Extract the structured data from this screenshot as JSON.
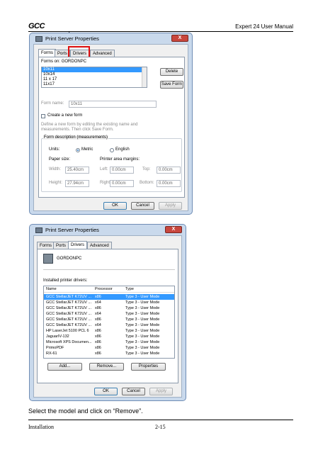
{
  "header": {
    "logo": "GCC",
    "doc_title": "Expert 24 User Manual"
  },
  "dialog1": {
    "title": "Print Server Properties",
    "tabs": [
      "Forms",
      "Ports",
      "Drivers",
      "Advanced"
    ],
    "active_tab": "Forms",
    "forms_on_label": "Forms on:",
    "server_name": "GORDONPC",
    "forms_list": [
      "10x11",
      "10x14",
      "11 x 17",
      "11x17"
    ],
    "delete_button": "Delete",
    "save_form_button": "Save Form",
    "form_name_label": "Form name:",
    "form_name_value": "10x11",
    "create_new_form_label": "Create a new form",
    "help_text_line1": "Define a new form by editing the existing name and",
    "help_text_line2": "measurements. Then click Save Form.",
    "form_description_title": "Form description (measurements)",
    "units_label": "Units:",
    "metric_label": "Metric",
    "english_label": "English",
    "paper_size_label": "Paper size:",
    "width_label": "Width:",
    "width_value": "25.40cm",
    "height_label": "Height:",
    "height_value": "27.94cm",
    "margins_label": "Printer area margins:",
    "left_label": "Left:",
    "left_value": "0.00cm",
    "right_label": "Right:",
    "right_value": "0.00cm",
    "top_label": "Top:",
    "top_value": "0.00cm",
    "bottom_label": "Bottom:",
    "bottom_value": "0.00cm",
    "ok_button": "OK",
    "cancel_button": "Cancel",
    "apply_button": "Apply",
    "close_glyph": "X"
  },
  "dialog2": {
    "title": "Print Server Properties",
    "tabs": [
      "Forms",
      "Ports",
      "Drivers",
      "Advanced"
    ],
    "active_tab": "Drivers",
    "server_name": "GORDONPC",
    "installed_label": "Installed printer drivers:",
    "columns": [
      "Name",
      "Processor",
      "Type"
    ],
    "rows": [
      [
        "GCC StellarJET K72UV ...",
        "x86",
        "Type 3 - User Mode"
      ],
      [
        "GCC StellarJET K72UV ...",
        "x64",
        "Type 3 - User Mode"
      ],
      [
        "GCC StellarJET K72UV ...",
        "x86",
        "Type 3 - User Mode"
      ],
      [
        "GCC StellarJET K72UV ...",
        "x64",
        "Type 3 - User Mode"
      ],
      [
        "GCC StellarJET K72UV ...",
        "x86",
        "Type 3 - User Mode"
      ],
      [
        "GCC StellarJET K72UV ...",
        "x64",
        "Type 3 - User Mode"
      ],
      [
        "HP LaserJet 5100 PCL 6",
        "x86",
        "Type 3 - User Mode"
      ],
      [
        "JaguarIV-132",
        "x86",
        "Type 3 - User Mode"
      ],
      [
        "Microsoft XPS Documen...",
        "x86",
        "Type 3 - User Mode"
      ],
      [
        "PrimoPDF",
        "x86",
        "Type 3 - User Mode"
      ],
      [
        "RX-61",
        "x86",
        "Type 3 - User Mode"
      ]
    ],
    "add_button": "Add...",
    "remove_button": "Remove...",
    "properties_button": "Properties",
    "ok_button": "OK",
    "cancel_button": "Cancel",
    "apply_button": "Apply",
    "close_glyph": "X"
  },
  "caption": "Select the model and click on “Remove”.",
  "footer": {
    "section": "Installation",
    "page": "2-15"
  },
  "colors": {
    "highlight": "#e01010",
    "selection": "#3399ff",
    "window_frame": "#c9d9ec"
  }
}
